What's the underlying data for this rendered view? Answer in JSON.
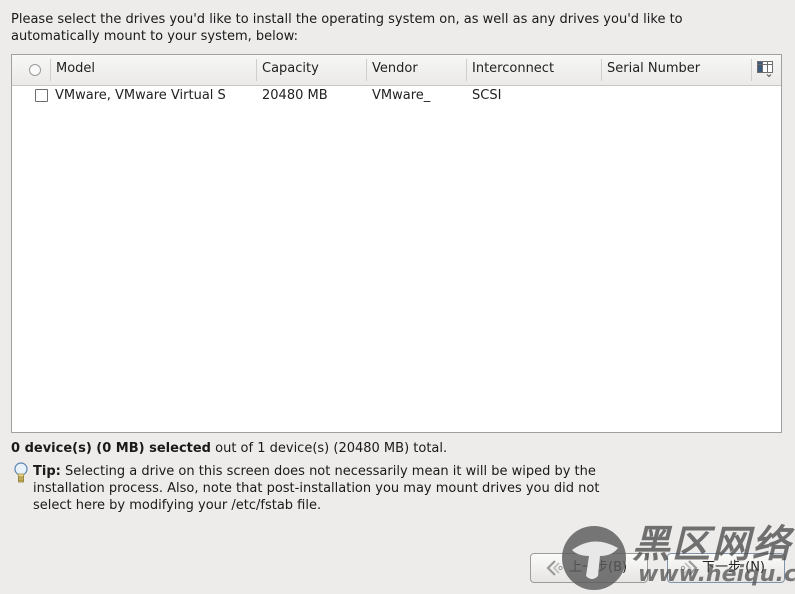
{
  "intro_text": "Please select the drives you'd like to install the operating system on, as well as any drives you'd like to automatically mount to your system, below:",
  "table": {
    "columns": [
      "Model",
      "Capacity",
      "Vendor",
      "Interconnect",
      "Serial Number"
    ],
    "select_all_icon": "radio-icon",
    "column_picker_icon": "column-chooser-icon",
    "rows": [
      {
        "checked": false,
        "model": "VMware, VMware Virtual S",
        "capacity": "20480 MB",
        "vendor": "VMware_",
        "interconnect": "SCSI",
        "serial": ""
      }
    ]
  },
  "summary": {
    "selected_bold": "0 device(s) (0 MB) selected",
    "rest": " out of 1 device(s) (20480 MB) total."
  },
  "tip": {
    "icon": "lightbulb-icon",
    "label": "Tip:",
    "text": " Selecting a drive on this screen does not necessarily mean it will be wiped by the installation process.  Also, note that post-installation you may mount drives you did not select here by modifying your /etc/fstab file."
  },
  "buttons": {
    "back_label": "上一步(B)",
    "next_label": "下一步 (N)",
    "back_icon": "back-arrow-icon",
    "next_icon": "forward-arrow-icon"
  },
  "watermark": {
    "text_cn": "黑区网络",
    "url": "www.heiqu.com"
  }
}
